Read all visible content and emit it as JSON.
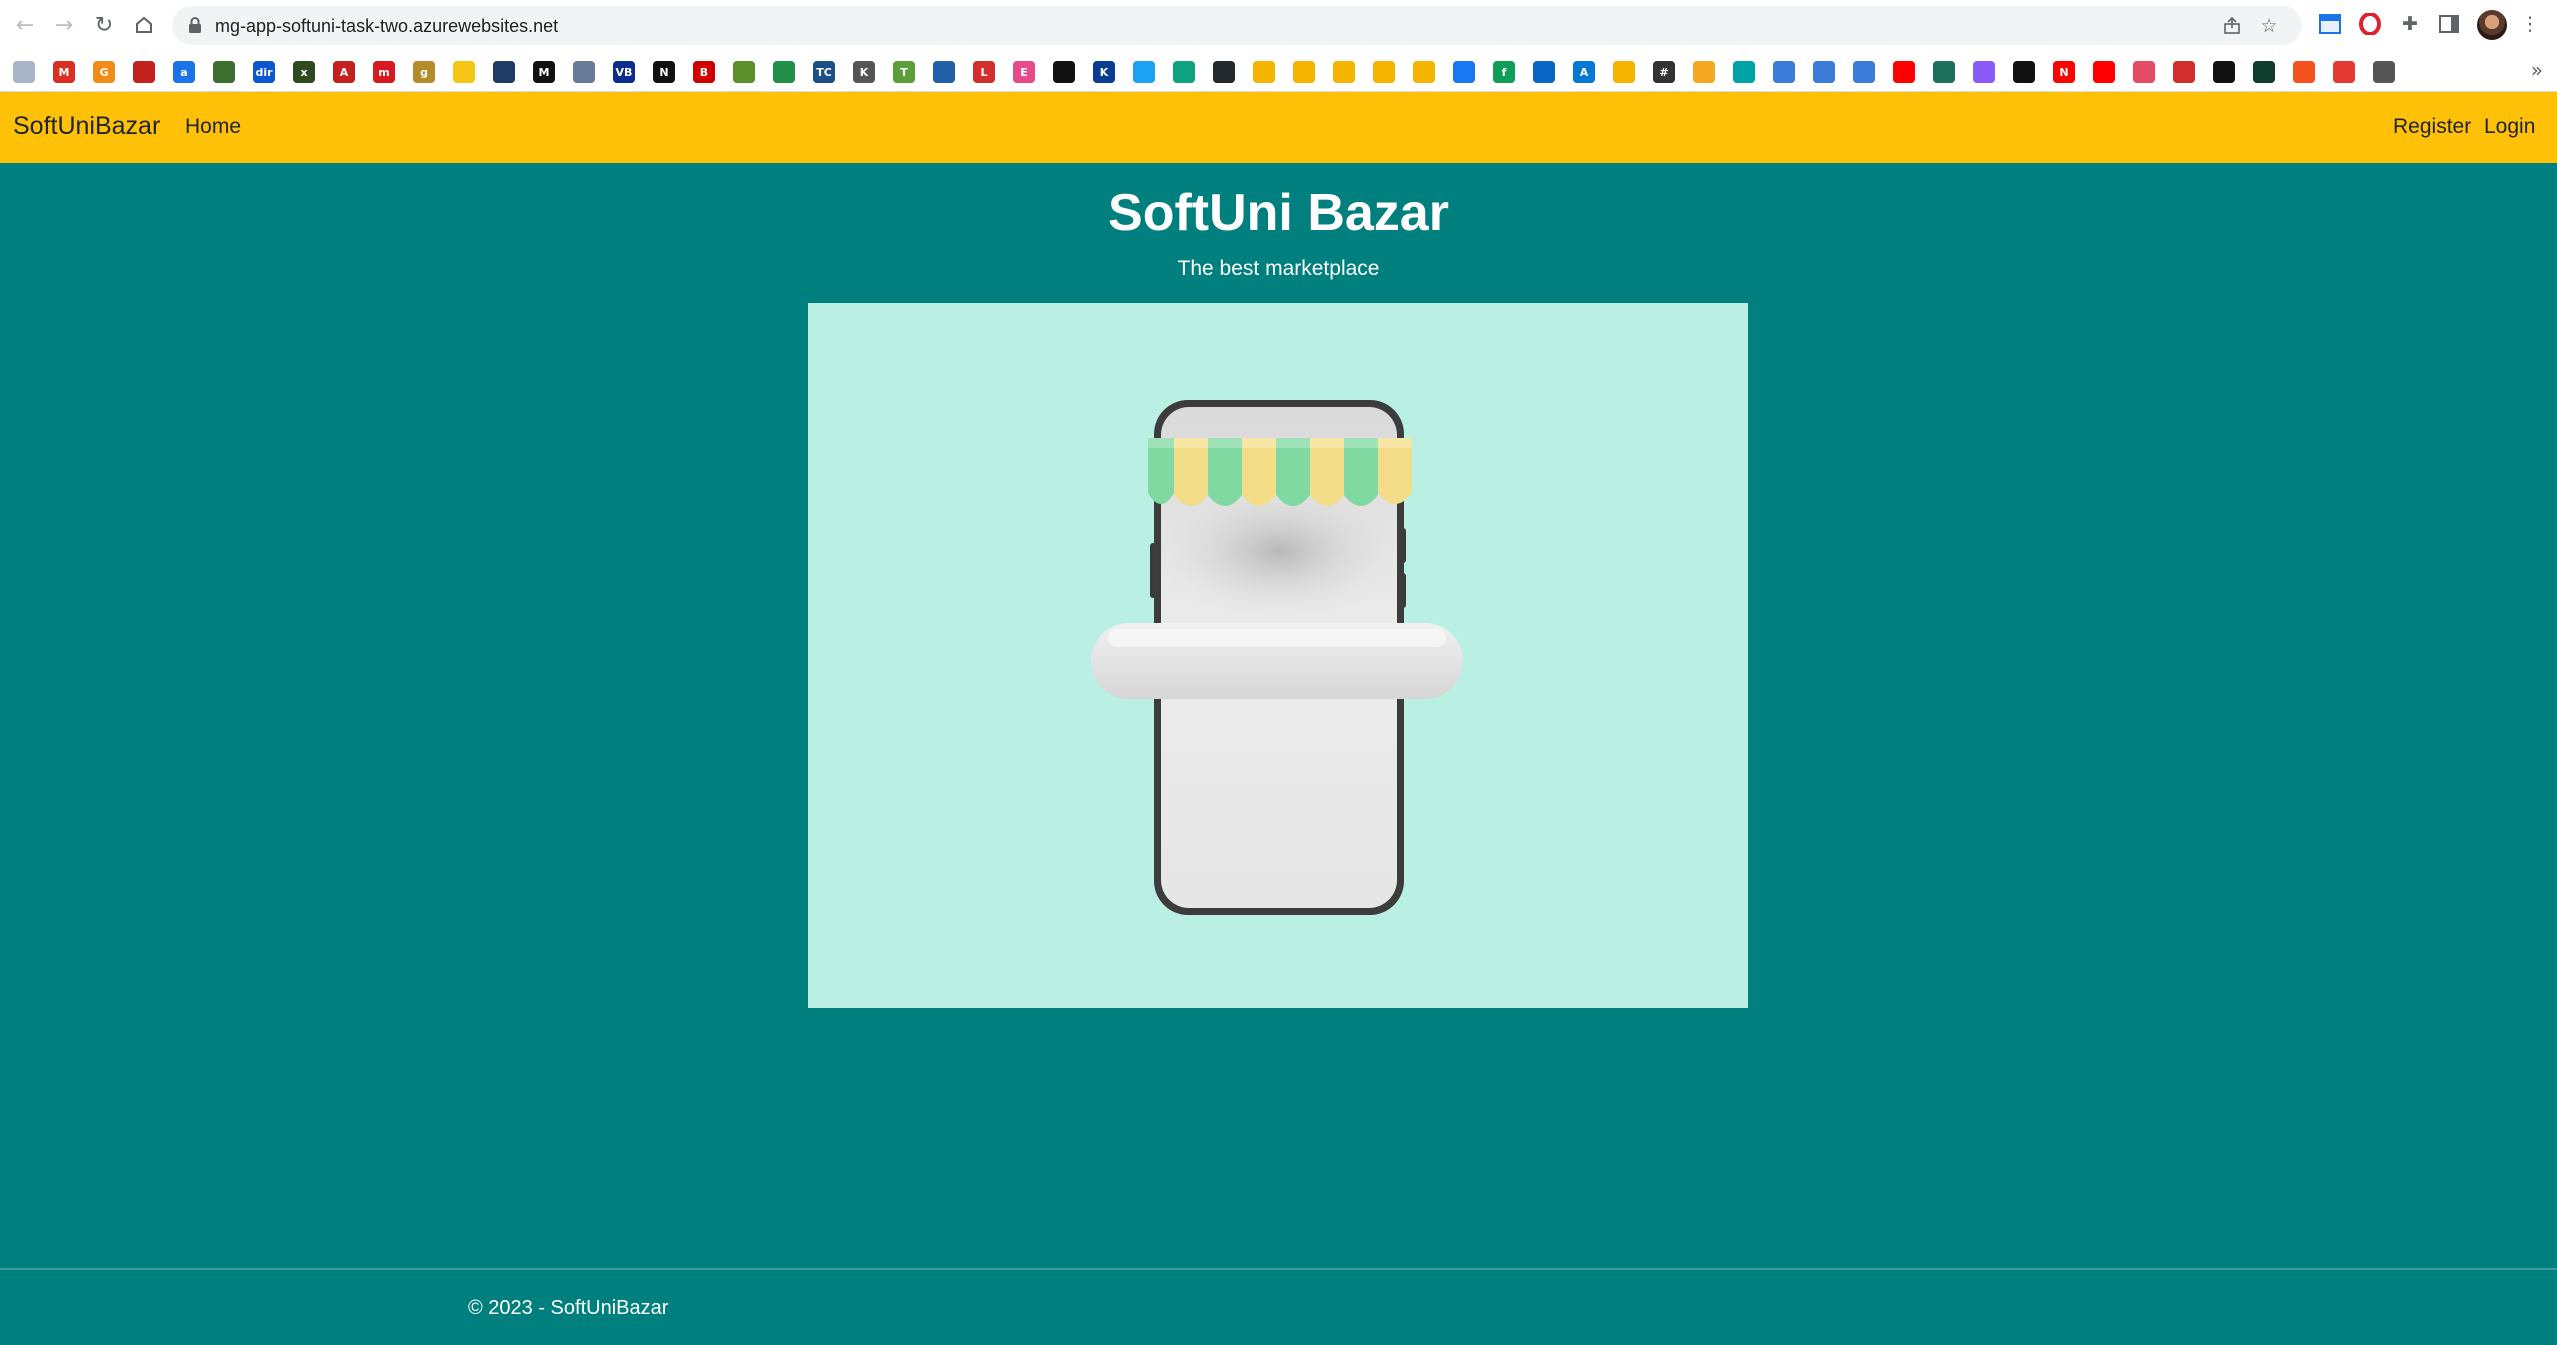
{
  "browser": {
    "url": "mg-app-softuni-task-two.azurewebsites.net",
    "icons": {
      "back": "arrow-left-icon",
      "forward": "arrow-right-icon",
      "reload": "reload-icon",
      "home": "home-icon",
      "share": "share-icon",
      "bookmark": "star-icon",
      "extensions": "puzzle-icon",
      "side_panel": "side-panel-icon",
      "menu": "kebab-menu-icon"
    },
    "bookmarks_more": "»",
    "bookmark_colors": [
      "#a8b4c8",
      "#d93025",
      "#f28b18",
      "#c5221f",
      "#1a73e8",
      "#3c6e2f",
      "#0b57d0",
      "#2e4a1f",
      "#c5221f",
      "#d61a1f",
      "#b58a28",
      "#f5c518",
      "#1f3b66",
      "#111111",
      "#6a7b9a",
      "#0c2f8f",
      "#111111",
      "#d00000",
      "#5b8f2c",
      "#1f8f4a",
      "#1b4f8a",
      "#555555",
      "#5c9e3a",
      "#1f5fa8",
      "#d32f2f",
      "#e64a8a",
      "#111111",
      "#0a3d91",
      "#1da1f2",
      "#10a37f",
      "#24292e",
      "#f4b400",
      "#f4b400",
      "#f4b400",
      "#f4b400",
      "#f4b400",
      "#1877f2",
      "#0f9d58",
      "#0a66c2",
      "#0078d4",
      "#f4b400",
      "#333333",
      "#f5a623",
      "#00a4a6",
      "#3d7bd8",
      "#3d7bd8",
      "#3d7bd8",
      "#ff0000",
      "#1e6f5c",
      "#8a5cf6",
      "#111111",
      "#ff0000",
      "#ff0000",
      "#e44c65",
      "#d32f2f",
      "#111111",
      "#0f3d2e",
      "#f4511e",
      "#e53935",
      "#555555"
    ],
    "bookmark_glyphs": [
      "",
      "M",
      "G",
      "",
      "a",
      "",
      "dir",
      "x",
      "A",
      "m",
      "g",
      "",
      "",
      "M",
      "",
      "VB",
      "N",
      "B",
      "",
      "",
      "TC",
      "K",
      "T",
      "",
      "L",
      "E",
      "",
      "K",
      "",
      "",
      "",
      "",
      "",
      "",
      "",
      "",
      "",
      "f",
      "",
      "A",
      "",
      "#",
      "",
      "",
      "",
      "",
      "",
      "",
      "",
      "",
      "",
      "N",
      "",
      "",
      "",
      "",
      "",
      "",
      "",
      "",
      ""
    ]
  },
  "navbar": {
    "brand": "SoftUniBazar",
    "home": "Home",
    "register": "Register",
    "login": "Login",
    "color": "#ffc107"
  },
  "main": {
    "title": "SoftUni Bazar",
    "subtitle": "The best marketplace",
    "background_color": "#007f7f",
    "image_background": "#baf0e4"
  },
  "footer": {
    "text": "© 2023 - SoftUniBazar"
  }
}
